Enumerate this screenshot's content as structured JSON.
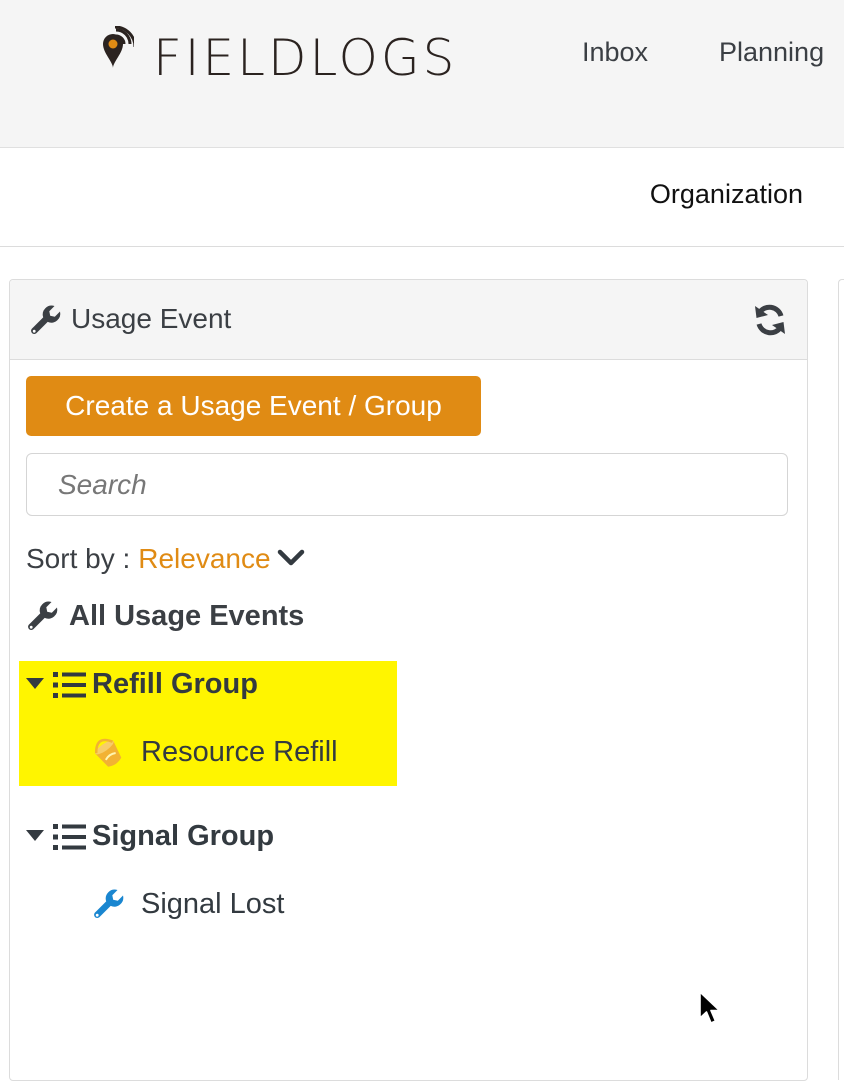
{
  "header": {
    "logo_text": "FIELDLOGS",
    "nav": [
      {
        "label": "Inbox"
      },
      {
        "label": "Planning"
      }
    ]
  },
  "subnav": {
    "organization_label": "Organization"
  },
  "panel": {
    "title": "Usage Event",
    "title_icon": "wrench-icon",
    "refresh_icon": "refresh-icon",
    "create_button_label": "Create a Usage Event / Group",
    "search_placeholder": "Search",
    "sort": {
      "label": "Sort by :",
      "value": "Relevance"
    },
    "all_events_label": "All Usage Events",
    "groups": [
      {
        "name": "Refill Group",
        "highlighted": true,
        "items": [
          {
            "label": "Resource Refill",
            "icon": "bucket-icon"
          }
        ]
      },
      {
        "name": "Signal Group",
        "highlighted": false,
        "items": [
          {
            "label": "Signal Lost",
            "icon": "wrench-icon"
          }
        ]
      }
    ]
  },
  "colors": {
    "accent": "#e08b14",
    "highlight": "#fff500",
    "wrench_blue": "#1a86d0",
    "text": "#333a40"
  }
}
